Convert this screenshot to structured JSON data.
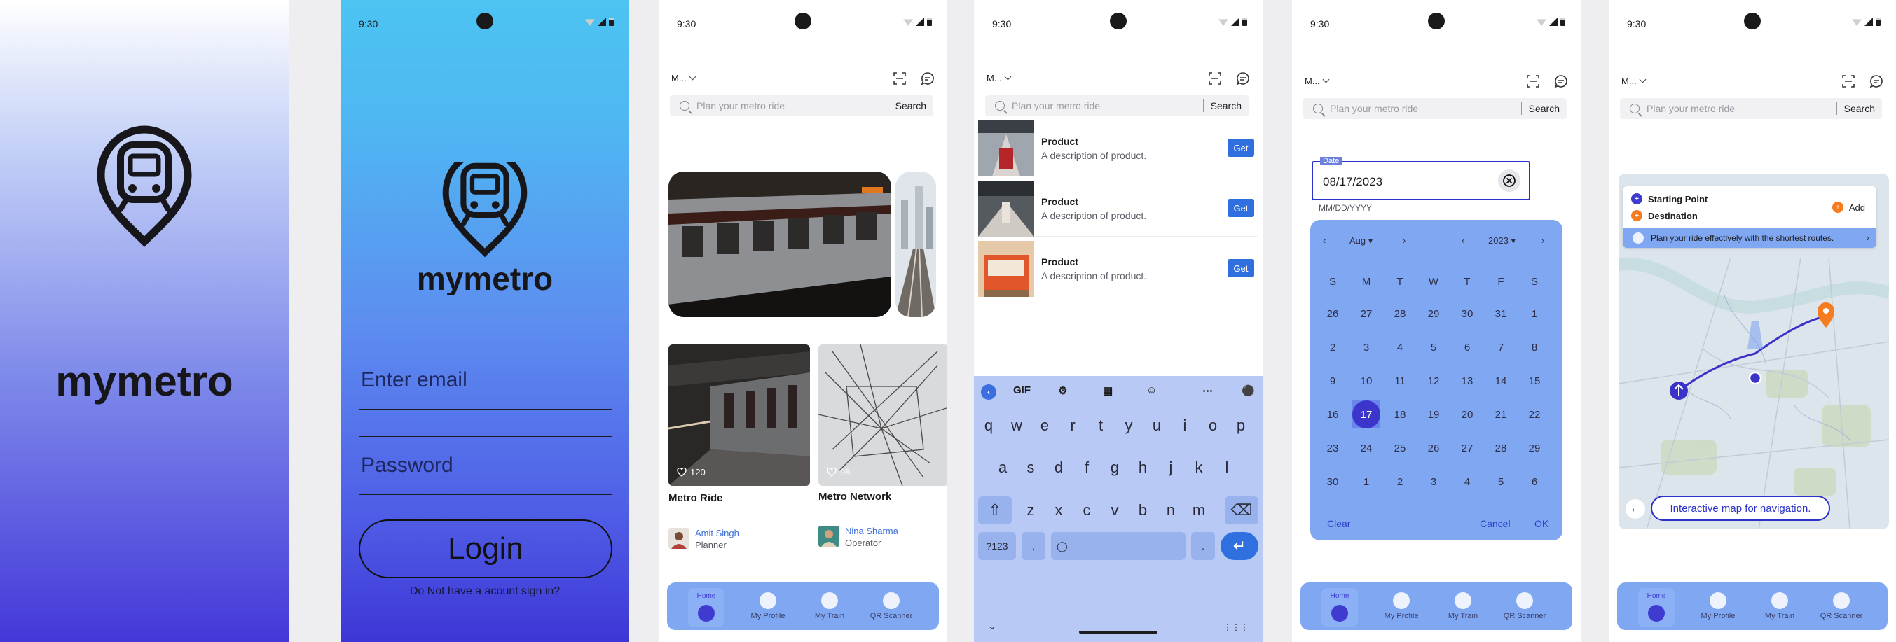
{
  "brand": {
    "name": "mymetro"
  },
  "status": {
    "time": "9:30"
  },
  "login": {
    "email_placeholder": "Enter email",
    "password_placeholder": "Password",
    "login_label": "Login",
    "signup_text": "Do Not have a acount sign in?"
  },
  "header": {
    "location": "M...",
    "search_placeholder": "Plan your metro ride",
    "search_label": "Search"
  },
  "tabbar": {
    "items": [
      "Home",
      "My Profile",
      "My Train",
      "QR Scanner"
    ]
  },
  "home": {
    "cards": [
      {
        "title": "Metro Ride",
        "likes": "120",
        "author": "Amit Singh",
        "role": "Planner"
      },
      {
        "title": "Metro Network",
        "likes": "98",
        "author": "Nina Sharma",
        "role": "Operator"
      }
    ]
  },
  "products": [
    {
      "title": "Product",
      "desc": "A description of product.",
      "action": "Get"
    },
    {
      "title": "Product",
      "desc": "A description of product.",
      "action": "Get"
    },
    {
      "title": "Product",
      "desc": "A description of product.",
      "action": "Get"
    }
  ],
  "keyboard": {
    "toolbar_gif": "GIF",
    "row1": [
      "q",
      "w",
      "e",
      "r",
      "t",
      "y",
      "u",
      "i",
      "o",
      "p"
    ],
    "row2": [
      "a",
      "s",
      "d",
      "f",
      "g",
      "h",
      "j",
      "k",
      "l"
    ],
    "row3": [
      "z",
      "x",
      "c",
      "v",
      "b",
      "n",
      "m"
    ],
    "sym_label": "?123",
    "comma": ",",
    "period": "."
  },
  "date": {
    "label": "Date",
    "value": "08/17/2023",
    "hint": "MM/DD/YYYY",
    "month": "Aug",
    "year": "2023",
    "weekdays": [
      "S",
      "M",
      "T",
      "W",
      "T",
      "F",
      "S"
    ],
    "weeks": [
      [
        "26",
        "27",
        "28",
        "29",
        "30",
        "31",
        "1"
      ],
      [
        "2",
        "3",
        "4",
        "5",
        "6",
        "7",
        "8"
      ],
      [
        "9",
        "10",
        "11",
        "12",
        "13",
        "14",
        "15"
      ],
      [
        "16",
        "17",
        "18",
        "19",
        "20",
        "21",
        "22"
      ],
      [
        "23",
        "24",
        "25",
        "26",
        "27",
        "28",
        "29"
      ],
      [
        "30",
        "1",
        "2",
        "3",
        "4",
        "5",
        "6"
      ]
    ],
    "selected": "17",
    "clear_label": "Clear",
    "cancel_label": "Cancel",
    "ok_label": "OK"
  },
  "map": {
    "start_label": "Starting Point",
    "dest_label": "Destination",
    "add_label": "Add",
    "hint": "Plan your ride effectively with the shortest routes.",
    "tip": "Interactive map for navigation."
  },
  "colors": {
    "accent": "#3f3bd0",
    "tabbar": "#7fa7f2",
    "primary_button": "#2f6fe0",
    "destination": "#f57c1f"
  }
}
